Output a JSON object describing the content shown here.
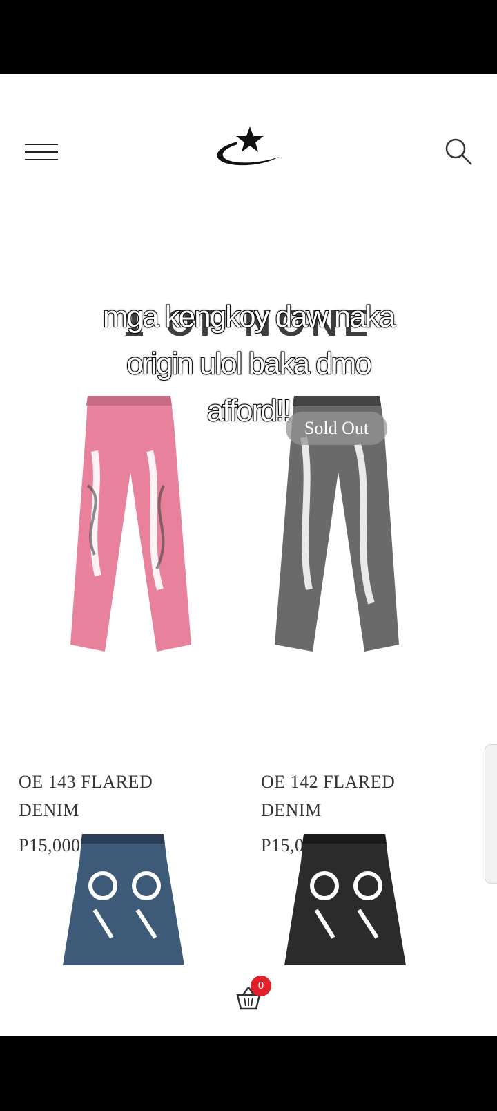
{
  "header": {
    "menu_icon": "hamburger-menu-icon",
    "logo_icon": "star-swoosh-logo-icon",
    "search_icon": "search-icon"
  },
  "brand_title": "1 OF NONE",
  "caption": {
    "line1": "mga kengkoy daw naka",
    "line2": "origin  ulol baka dmo",
    "line3": "afford!!"
  },
  "products": [
    {
      "name_line1": "OE 143 FLARED",
      "name_line2": "DENIM",
      "price": "₱15,000.00",
      "color": "#e8829c"
    },
    {
      "name_line1": "OE 142 FLARED",
      "name_line2": "DENIM",
      "price": "₱15,000.00",
      "badge": "Sold Out",
      "color": "#6a6a6a"
    },
    {
      "color": "#3d5a78"
    },
    {
      "color": "#2b2b2b"
    }
  ],
  "cart": {
    "icon": "basket-icon",
    "count": "0",
    "badge_color": "#e0202a"
  }
}
